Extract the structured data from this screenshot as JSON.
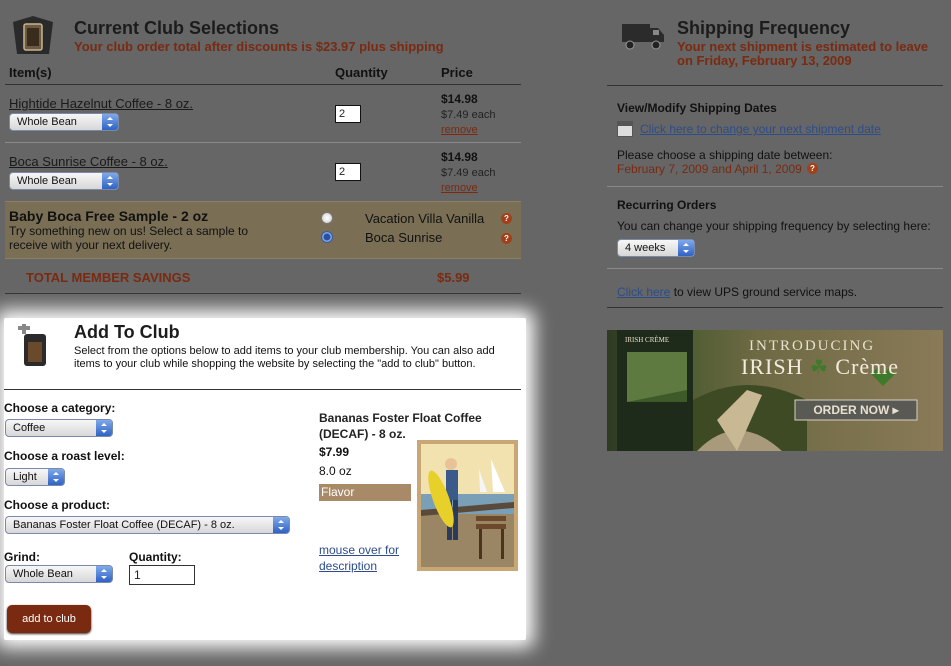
{
  "club": {
    "title": "Current Club Selections",
    "subtitle": "Your club order total after discounts is $23.97 plus shipping",
    "columns": {
      "item": "Item(s)",
      "quantity": "Quantity",
      "price": "Price"
    },
    "items": [
      {
        "name": "Hightide Hazelnut Coffee - 8 oz.",
        "grind": "Whole Bean",
        "qty": "2",
        "price": "$14.98",
        "each": "$7.49 each",
        "remove": "remove"
      },
      {
        "name": "Boca Sunrise Coffee - 8 oz.",
        "grind": "Whole Bean",
        "qty": "2",
        "price": "$14.98",
        "each": "$7.49 each",
        "remove": "remove"
      }
    ],
    "sample": {
      "title": "Baby Boca Free Sample - 2 oz",
      "desc": "Try something new on us! Select a sample to receive with your next delivery.",
      "options": [
        {
          "label": "Vacation Villa Vanilla",
          "selected": false
        },
        {
          "label": "Boca Sunrise",
          "selected": true
        }
      ],
      "help": "?"
    },
    "savings_label": "TOTAL MEMBER SAVINGS",
    "savings_value": "$5.99"
  },
  "add": {
    "title": "Add To Club",
    "desc": "Select from the options below to add items to your club membership. You can also add items to your club while shopping the website by selecting the \"add to club\" button.",
    "category_label": "Choose a category:",
    "category_value": "Coffee",
    "roast_label": "Choose a roast level:",
    "roast_value": "Light",
    "product_label": "Choose a product:",
    "product_value": "Bananas Foster Float Coffee (DECAF) - 8 oz.",
    "grind_label": "Grind:",
    "grind_value": "Whole Bean",
    "quantity_label": "Quantity:",
    "quantity_value": "1",
    "button": "add to club",
    "product": {
      "name_line1": "Bananas Foster Float Coffee",
      "name_line2": "(DECAF) - 8 oz.",
      "price": "$7.99",
      "size": "8.0 oz",
      "flavor": "Flavor",
      "mouseover1": "mouse over for",
      "mouseover2": "description"
    }
  },
  "shipping": {
    "title": "Shipping Frequency",
    "subtitle1": "Your next shipment is estimated to leave",
    "subtitle2": "on Friday, February 13, 2009",
    "dates_heading": "View/Modify Shipping Dates",
    "dates_link": "Click here to change your next shipment date",
    "dates_text": "Please choose a shipping date between:",
    "dates_range": "February 7, 2009 and April 1, 2009",
    "recurring_heading": "Recurring Orders",
    "recurring_text": "You can change your shipping frequency by selecting here:",
    "frequency": "4 weeks",
    "ups_link": "Click here",
    "ups_text": " to view UPS ground service maps."
  },
  "banner": {
    "intro": "INTRODUCING",
    "brand1": "IRISH",
    "brand2": "Crème",
    "bag_label": "IRISH CRÈME",
    "cta": "ORDER NOW ▸"
  },
  "colors": {
    "accent": "#7a2a10",
    "button": "#7b2a12",
    "flavor_bar": "#a88a68"
  }
}
